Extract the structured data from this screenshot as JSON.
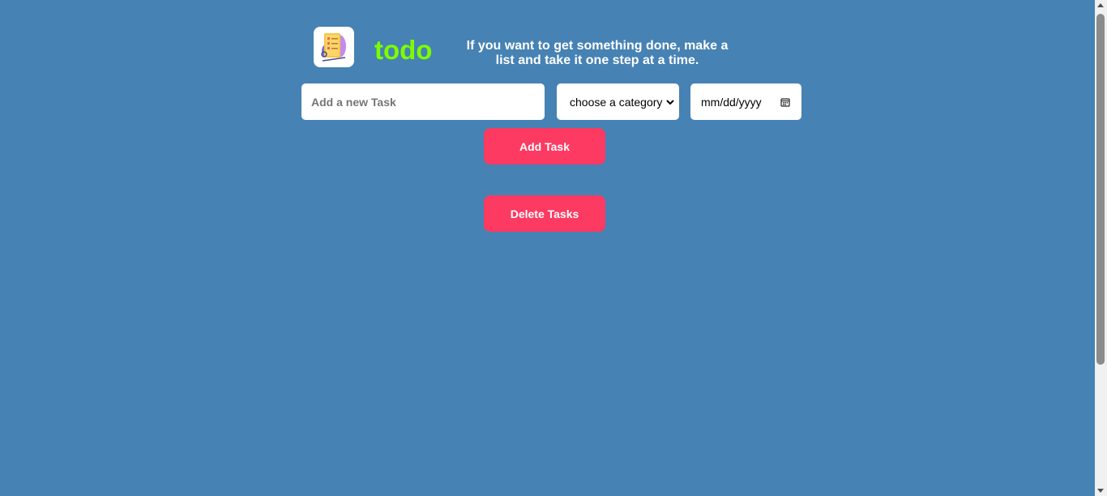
{
  "header": {
    "title": "todo",
    "tagline": "If you want to get something done, make a list and take it one step at a time.",
    "title_color": "#7cfc00",
    "logo_icon": "checklist-notebook-icon"
  },
  "form": {
    "task_placeholder": "Add a new Task",
    "category_selected": "choose a category",
    "date_placeholder": "mm/dd/yyyy"
  },
  "buttons": {
    "add_label": "Add Task",
    "delete_label": "Delete Tasks",
    "color": "#fc3a62"
  },
  "colors": {
    "background": "#4682b4"
  }
}
